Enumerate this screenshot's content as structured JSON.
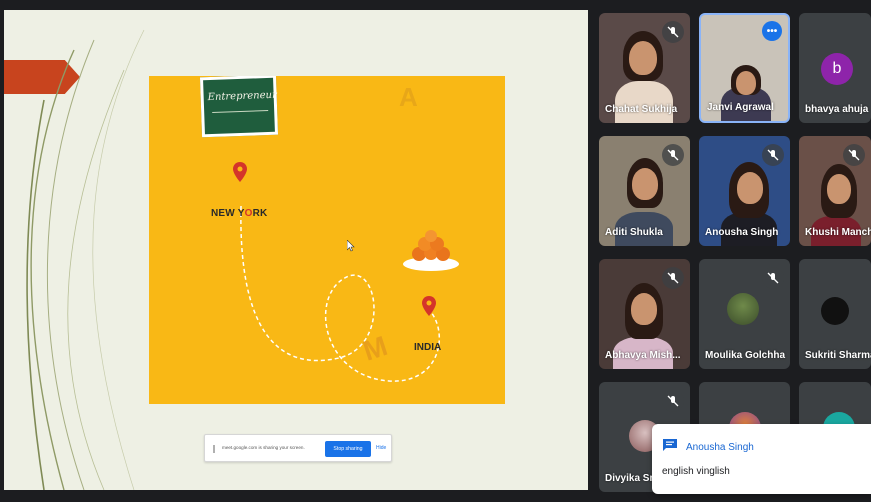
{
  "presentation": {
    "board_text": "Entrepreneur",
    "city_top_first": "NEW Y",
    "city_top_accent": "O",
    "city_top_rest": "RK",
    "city_bottom": "INDIA",
    "share_bar": {
      "text": "meet.google.com is sharing your screen.",
      "stop_label": "Stop sharing",
      "hide_label": "Hide"
    }
  },
  "participants": [
    {
      "name": "Chahat Sukhija",
      "muted": true
    },
    {
      "name": "Janvi Agrawal",
      "muted": false,
      "active": true
    },
    {
      "name": "bhavya ahuja",
      "avatar_letter": "b",
      "avatar_color": "#8e24aa"
    },
    {
      "name": "Aditi Shukla",
      "muted": true
    },
    {
      "name": "Anousha Singh",
      "muted": true
    },
    {
      "name": "Khushi Manch",
      "muted": true
    },
    {
      "name": "Abhavya Mish...",
      "muted": true
    },
    {
      "name": "Moulika Golchha",
      "muted": true
    },
    {
      "name": "Sukriti Sharma",
      "muted": true
    },
    {
      "name": "Divyika Sr",
      "muted": true
    }
  ],
  "chat_toast": {
    "sender": "Anousha Singh",
    "message": "english vinglish"
  },
  "colors": {
    "accent_blue": "#1a73e8",
    "slide_yellow": "#f9b815",
    "board_green": "#1f5d3d"
  }
}
